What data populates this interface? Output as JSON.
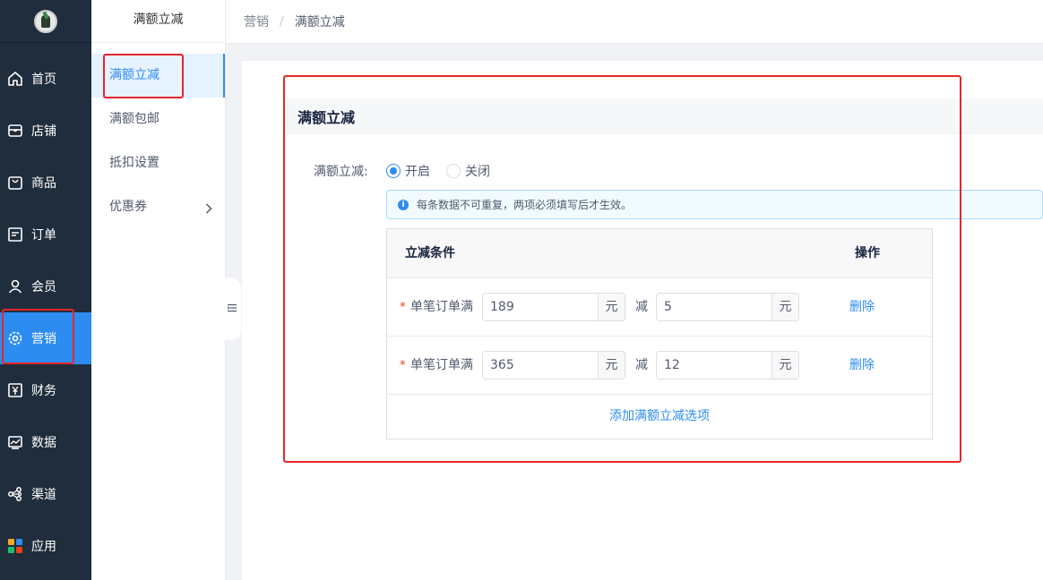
{
  "nav": {
    "items": [
      {
        "label": "首页",
        "icon": "home-icon"
      },
      {
        "label": "店铺",
        "icon": "store-icon"
      },
      {
        "label": "商品",
        "icon": "bag-icon"
      },
      {
        "label": "订单",
        "icon": "order-icon"
      },
      {
        "label": "会员",
        "icon": "user-icon"
      },
      {
        "label": "营销",
        "icon": "gear-icon",
        "active": true
      },
      {
        "label": "财务",
        "icon": "yen-icon"
      },
      {
        "label": "数据",
        "icon": "chart-icon"
      },
      {
        "label": "渠道",
        "icon": "share-icon"
      },
      {
        "label": "应用",
        "icon": "apps-icon"
      }
    ],
    "accent_color": "#2d8cf0",
    "bg_color": "#1f2d3d"
  },
  "subnav": {
    "title": "满额立减",
    "items": [
      {
        "label": "满额立减",
        "active": true
      },
      {
        "label": "满额包邮"
      },
      {
        "label": "抵扣设置"
      },
      {
        "label": "优惠券",
        "has_children": true
      }
    ]
  },
  "breadcrumb": {
    "parent": "营销",
    "separator": "/",
    "current": "满额立减"
  },
  "panel": {
    "title": "满额立减",
    "switch_label": "满额立减:",
    "options": [
      {
        "label": "开启",
        "checked": true
      },
      {
        "label": "关闭",
        "checked": false
      }
    ],
    "notice": "每条数据不可重复，两项必须填写后才生效。",
    "table": {
      "col_condition": "立减条件",
      "col_action": "操作",
      "rows": [
        {
          "label": "单笔订单满",
          "threshold": "189",
          "unit1": "元",
          "minus": "减",
          "discount": "5",
          "unit2": "元",
          "action": "删除"
        },
        {
          "label": "单笔订单满",
          "threshold": "365",
          "unit1": "元",
          "minus": "减",
          "discount": "12",
          "unit2": "元",
          "action": "删除"
        }
      ],
      "add_label": "添加满额立减选项"
    }
  }
}
